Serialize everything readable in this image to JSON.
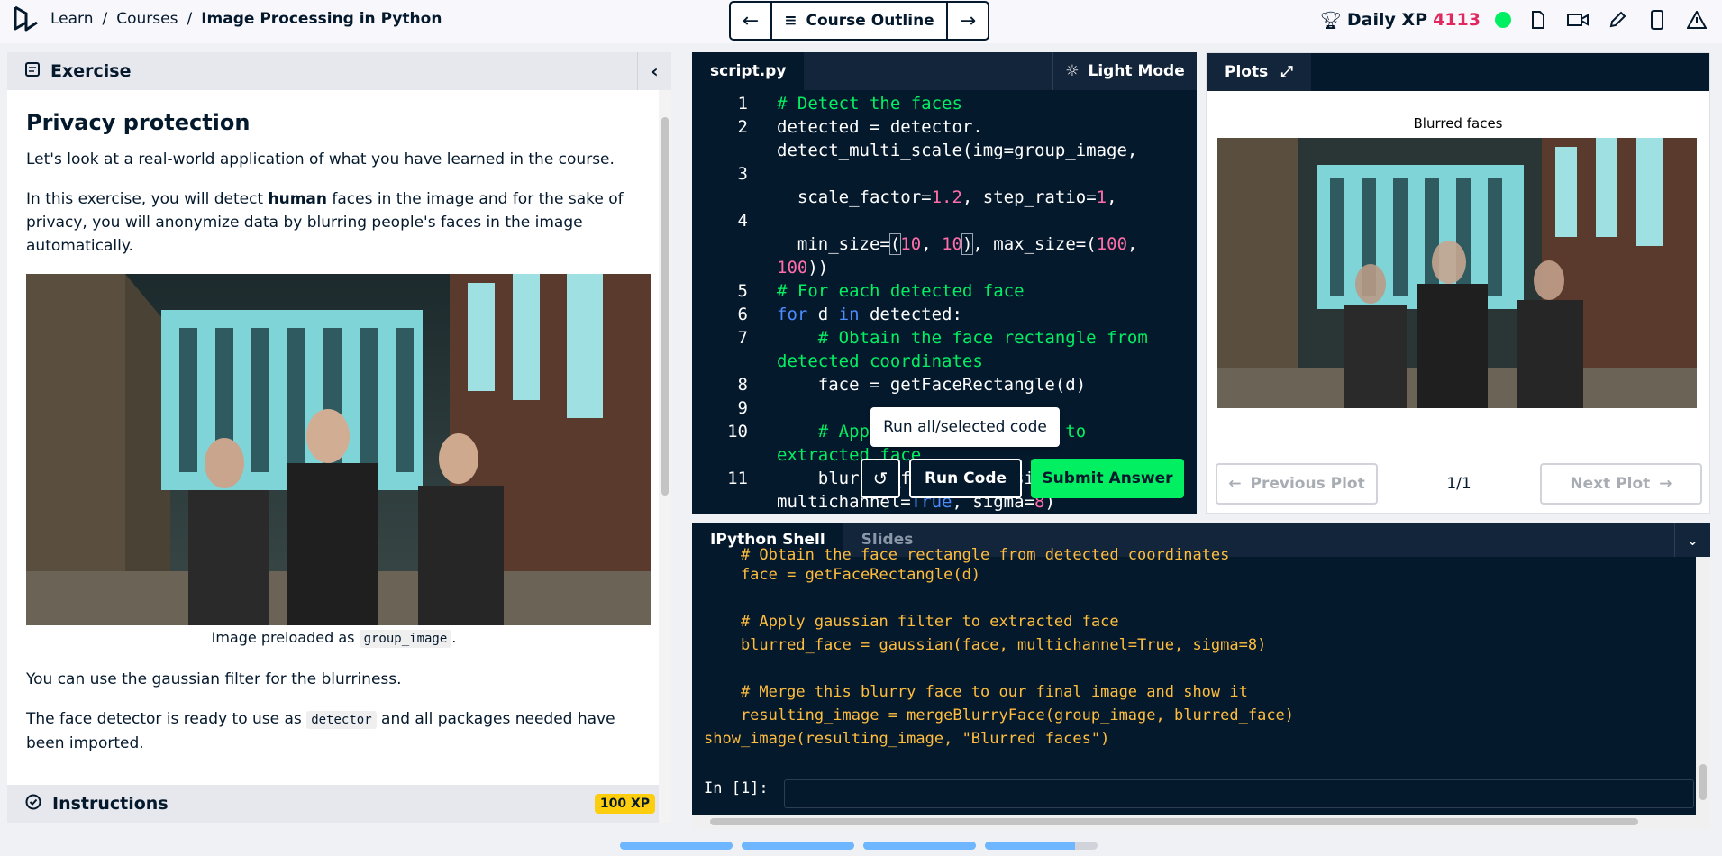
{
  "breadcrumb": {
    "items": [
      "Learn",
      "Courses"
    ],
    "current": "Image Processing in Python",
    "separator": "/"
  },
  "course_nav": {
    "outline_label": "Course Outline"
  },
  "header_right": {
    "xp_label": "Daily XP",
    "xp_value": "4113"
  },
  "exercise": {
    "header": "Exercise",
    "title": "Privacy protection",
    "para1": "Let's look at a real-world application of what you have learned in the course.",
    "para2_a": "In this exercise, you will detect ",
    "para2_bold": "human",
    "para2_b": " faces in the image and for the sake of privacy, you will anonymize data by blurring people's faces in the image automatically.",
    "caption_a": "Image preloaded as ",
    "caption_code": "group_image",
    "caption_b": ".",
    "para3": "You can use the gaussian filter for the blurriness.",
    "para4_a": "The face detector is ready to use as ",
    "para4_code": "detector",
    "para4_b": " and all packages needed have been imported.",
    "instructions_label": "Instructions",
    "xp_badge": "100 XP"
  },
  "editor": {
    "tab": "script.py",
    "light_mode": "Light Mode",
    "line_numbers": [
      "1",
      "2",
      "3",
      "4",
      "5",
      "6",
      "7",
      "8",
      "9",
      "10",
      "11"
    ],
    "tooltip": "Run all/selected code",
    "run_label": "Run Code",
    "submit_label": "Submit Answer"
  },
  "plots": {
    "tab": "Plots",
    "plot_title": "Blurred faces",
    "prev": "Previous Plot",
    "next": "Next Plot",
    "count": "1/1"
  },
  "shell": {
    "tab_active": "IPython Shell",
    "tab_inactive": "Slides",
    "lines": [
      "    # Obtain the face rectangle from detected coordinates",
      "    face = getFaceRectangle(d)",
      "",
      "    # Apply gaussian filter to extracted face",
      "    blurred_face = gaussian(face, multichannel=True, sigma=8)",
      "",
      "    # Merge this blurry face to our final image and show it",
      "    resulting_image = mergeBlurryFace(group_image, blurred_face)",
      "show_image(resulting_image, \"Blurred faces\")"
    ],
    "prompt": "In [1]:"
  },
  "progress": [
    1,
    1,
    1,
    0.8
  ],
  "colors": {
    "accent_green": "#03ef62",
    "navy": "#05192d",
    "xp_pink": "#e1295f",
    "badge_yellow": "#fcce0d"
  }
}
